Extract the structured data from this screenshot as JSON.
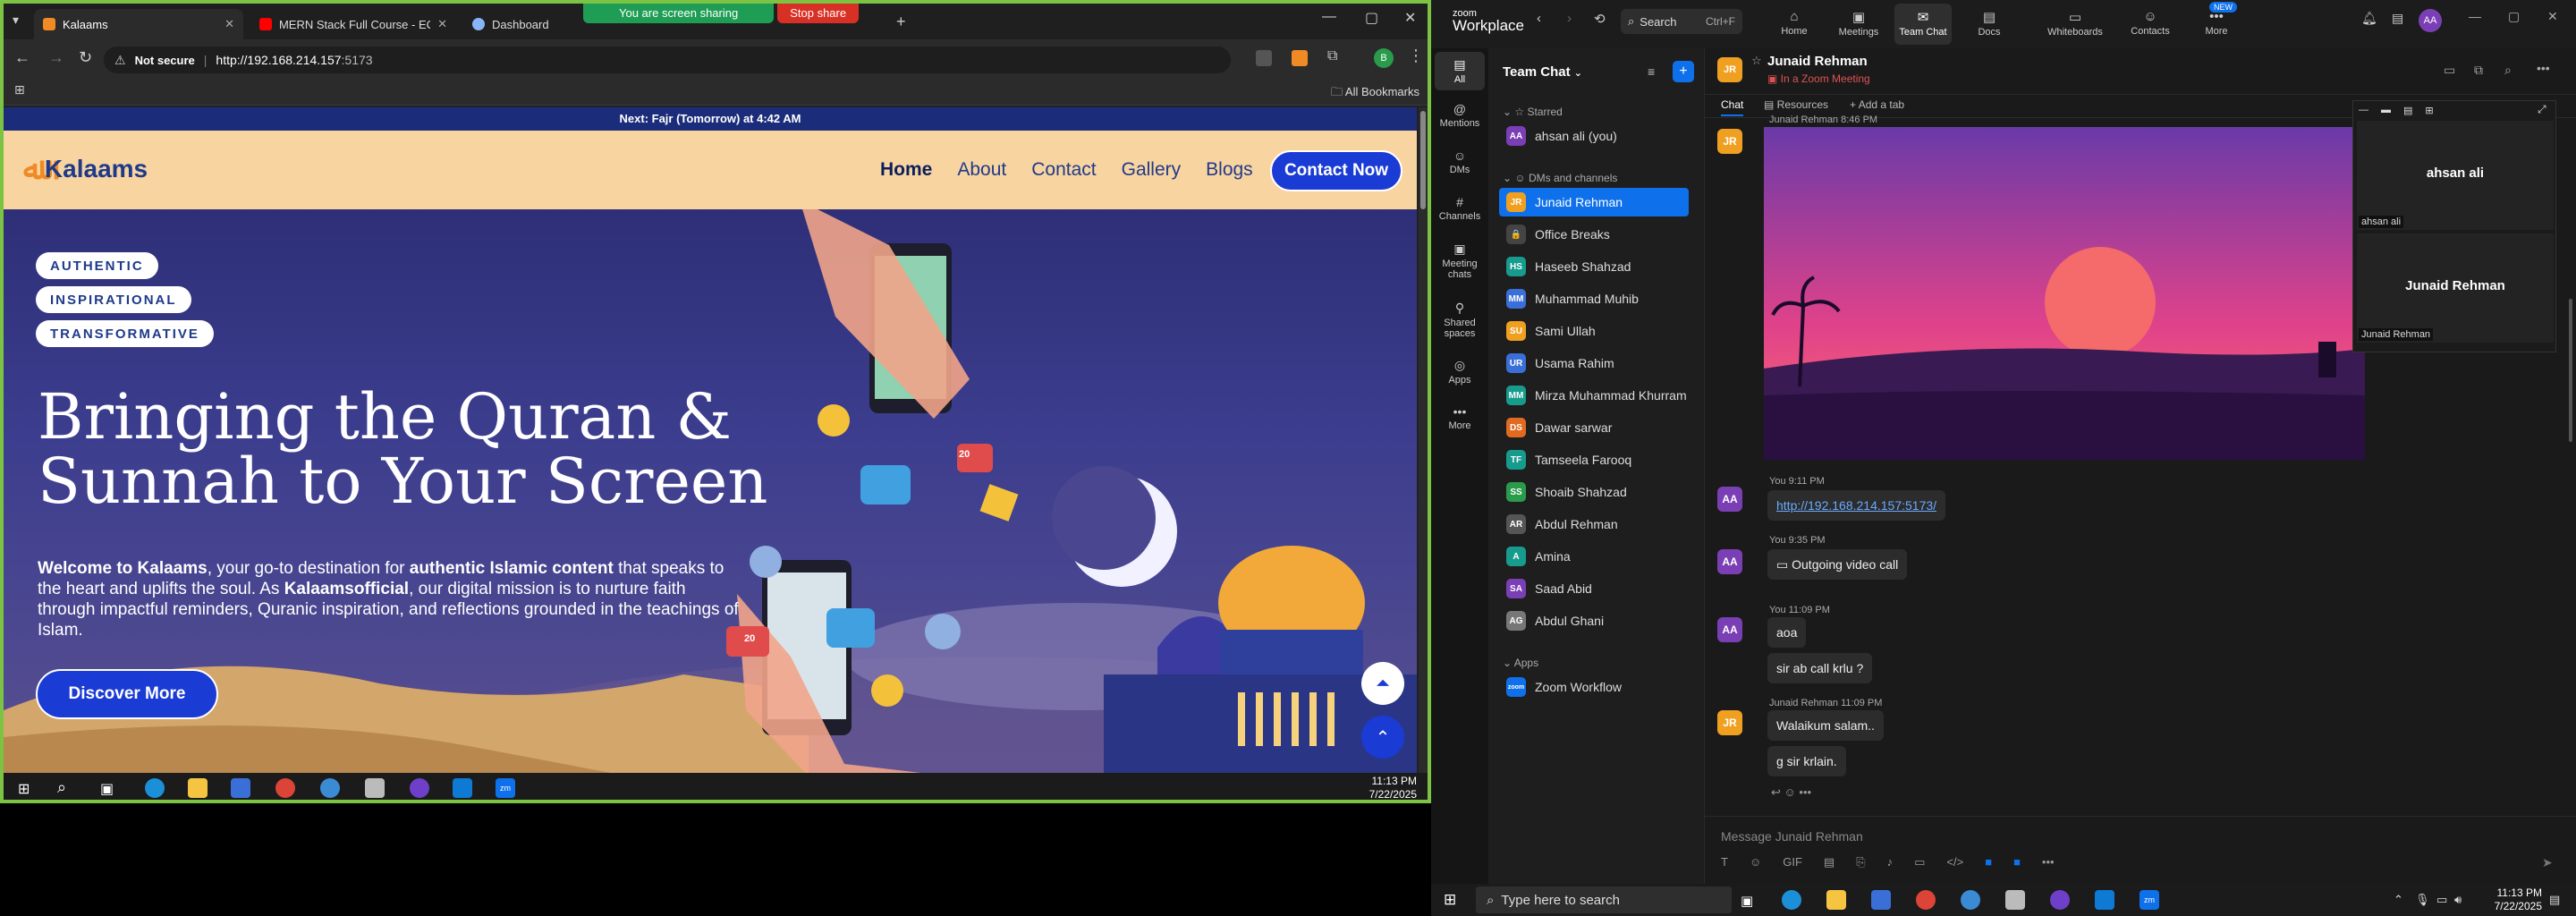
{
  "browser": {
    "tabs": [
      {
        "label": "Kalaams",
        "color": "#f08a24"
      },
      {
        "label": "MERN Stack Full Course - ECom",
        "color": "#ff0000"
      },
      {
        "label": "Dashboard",
        "color": "#8ab4f8"
      }
    ],
    "share_banner": {
      "status": "You are screen sharing",
      "stop": "Stop share"
    },
    "not_secure": "Not secure",
    "url_host": "http://192.168.214.157",
    "url_port": ":5173",
    "all_bookmarks": "All Bookmarks"
  },
  "site": {
    "prayer_bar": "Next: Fajr (Tomorrow) at 4:42 AM",
    "logo": "Kalaams",
    "nav": [
      "Home",
      "About",
      "Contact",
      "Gallery",
      "Blogs"
    ],
    "contact_btn": "Contact Now",
    "pills": [
      "AUTHENTIC",
      "INSPIRATIONAL",
      "TRANSFORMATIVE"
    ],
    "headline_1": "Bringing the Quran &",
    "headline_2": "Sunnah to Your Screen",
    "body_p1": "Welcome to Kalaams",
    "body_p2": ", your go-to destination for ",
    "body_p3": "authentic Islamic content",
    "body_p4": " that speaks to the heart and uplifts the soul. As ",
    "body_p5": "Kalaamsofficial",
    "body_p6": ", our digital mission is to nurture faith through impactful reminders, Quranic inspiration, and reflections grounded in the teachings of Islam.",
    "discover_btn": "Discover More",
    "badges": {
      "likes_1": "20",
      "likes_2": "20"
    }
  },
  "left_taskbar": {
    "time": "11:13 PM",
    "date": "7/22/2025"
  },
  "zoom": {
    "brand_small": "zoom",
    "brand_big": "Workplace",
    "search": "Search",
    "search_shortcut": "Ctrl+F",
    "tabs": [
      {
        "label": "Home",
        "icon": "⌂"
      },
      {
        "label": "Meetings",
        "icon": "▣"
      },
      {
        "label": "Team Chat",
        "icon": "✉"
      },
      {
        "label": "Docs",
        "icon": "▤"
      },
      {
        "label": "Whiteboards",
        "icon": "▭"
      },
      {
        "label": "Contacts",
        "icon": "☺"
      },
      {
        "label": "More",
        "icon": "•••"
      }
    ],
    "more_badge": "NEW",
    "user_avatar": "AA",
    "rail": [
      {
        "label": "All",
        "icon": "▤"
      },
      {
        "label": "Mentions",
        "icon": "@"
      },
      {
        "label": "DMs",
        "icon": "☺"
      },
      {
        "label": "Channels",
        "icon": "#"
      },
      {
        "label": "Meeting chats",
        "icon": "▣"
      },
      {
        "label": "Shared spaces",
        "icon": "⚲"
      },
      {
        "label": "Apps",
        "icon": "◎"
      },
      {
        "label": "More",
        "icon": "•••"
      }
    ],
    "list_title": "Team Chat",
    "starred_label": "Starred",
    "starred": [
      {
        "name": "ahsan ali (you)",
        "initials": "AA",
        "color": "#7b3fb5"
      }
    ],
    "dms_label": "DMs and channels",
    "dms": [
      {
        "name": "Junaid Rehman",
        "initials": "JR",
        "color": "#f0a020"
      },
      {
        "name": "Office Breaks",
        "initials": "🔒",
        "color": "#444444"
      },
      {
        "name": "Haseeb Shahzad",
        "initials": "HS",
        "color": "#169b8c"
      },
      {
        "name": "Muhammad Muhib",
        "initials": "MM",
        "color": "#3a6fd8"
      },
      {
        "name": "Sami Ullah",
        "initials": "SU",
        "color": "#f0a020"
      },
      {
        "name": "Usama Rahim",
        "initials": "UR",
        "color": "#3a6fd8"
      },
      {
        "name": "Mirza Muhammad Khurram",
        "initials": "MM",
        "color": "#169b8c"
      },
      {
        "name": "Dawar sarwar",
        "initials": "DS",
        "color": "#e06b20"
      },
      {
        "name": "Tamseela Farooq",
        "initials": "TF",
        "color": "#169b8c"
      },
      {
        "name": "Shoaib Shahzad",
        "initials": "SS",
        "color": "#2a9b4a"
      },
      {
        "name": "Abdul Rehman",
        "initials": "AR",
        "color": "#555555"
      },
      {
        "name": "Amina",
        "initials": "A",
        "color": "#169b8c"
      },
      {
        "name": "Saad Abid",
        "initials": "SA",
        "color": "#7b3fb5"
      },
      {
        "name": "Abdul Ghani",
        "initials": "AG",
        "color": "#777777"
      }
    ],
    "apps_label": "Apps",
    "apps": [
      {
        "name": "Zoom Workflow",
        "initials": "zoom",
        "color": "#0e71eb"
      }
    ],
    "chat": {
      "title": "Junaid Rehman",
      "status": "In a Zoom Meeting",
      "tabs": [
        "Chat",
        "Resources",
        "Add a tab"
      ],
      "img_meta": "Junaid Rehman 8:46 PM",
      "msg1_meta": "You 9:11 PM",
      "msg1_link": "http://192.168.214.157:5173/",
      "msg2_meta": "You 9:35 PM",
      "msg2_text": "Outgoing video call",
      "msg3_meta": "You 11:09 PM",
      "msg3_a": "aoa",
      "msg3_b": "sir ab call krlu ?",
      "msg4_meta": "Junaid Rehman 11:09 PM",
      "msg4_a": "Walaikum salam..",
      "msg4_b": "g sir krlain.",
      "compose_placeholder": "Message Junaid Rehman"
    },
    "share_panel": {
      "tile1_name": "ahsan ali",
      "tile1_label": "ahsan ali",
      "tile2_name": "Junaid Rehman",
      "tile2_label": "Junaid Rehman"
    }
  },
  "right_taskbar": {
    "search": "Type here to search",
    "time": "11:13 PM",
    "date": "7/22/2025"
  }
}
